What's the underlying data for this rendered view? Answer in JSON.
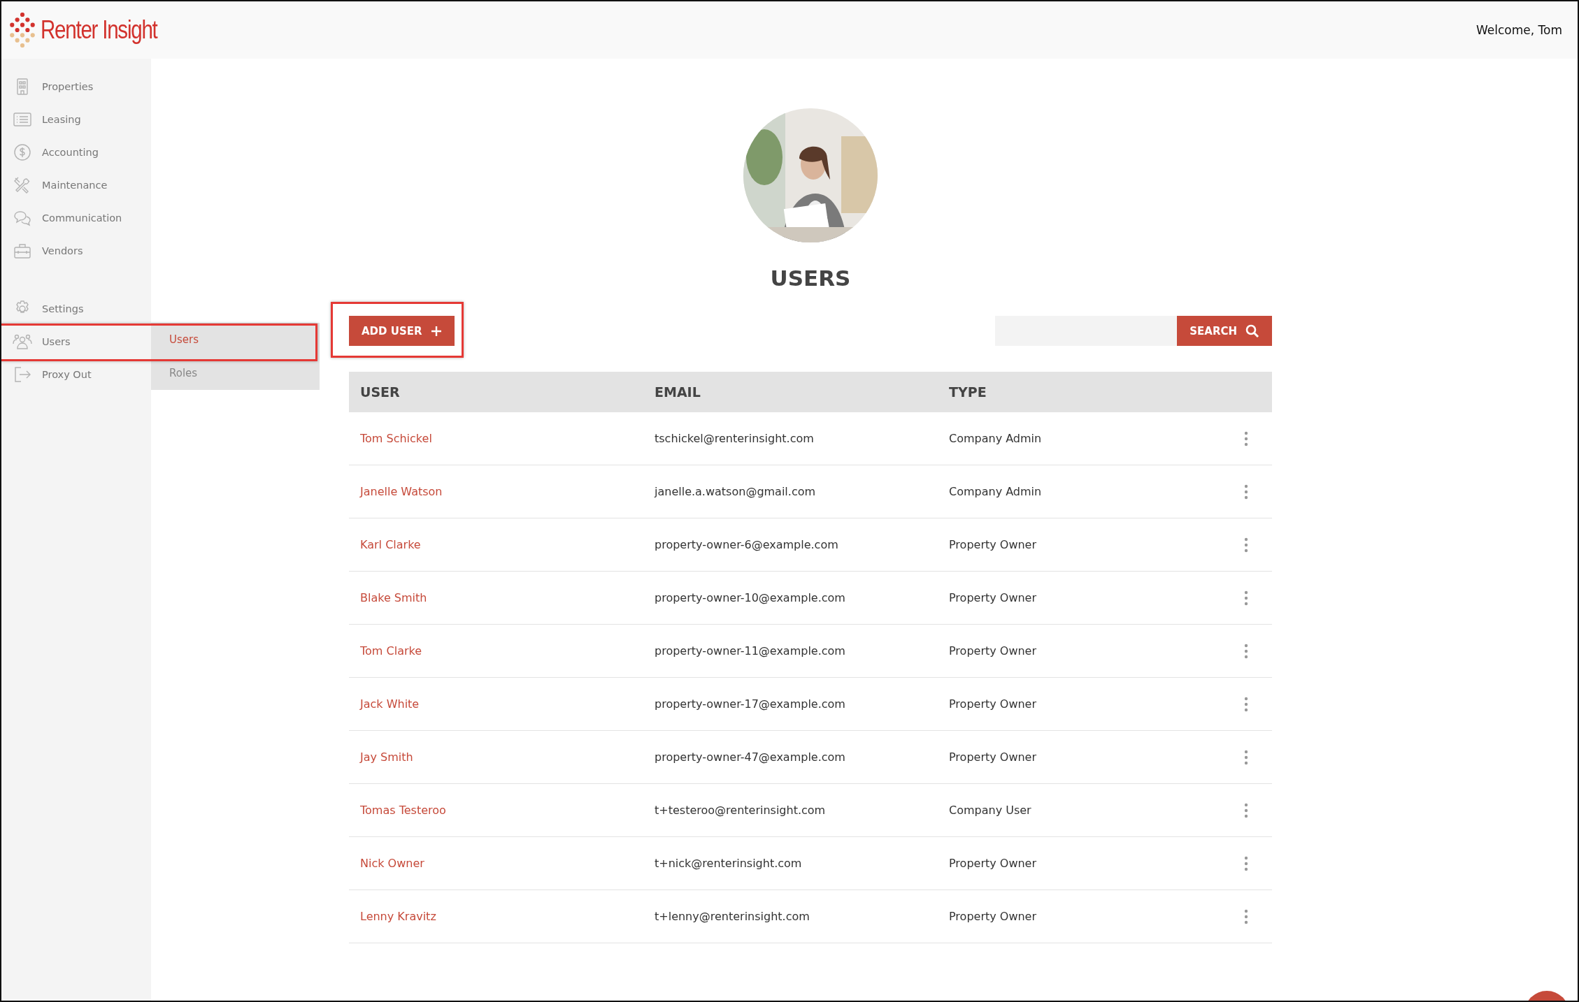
{
  "header": {
    "logo": "Renter Insight",
    "welcome": "Welcome, Tom"
  },
  "sidebar": {
    "main_items": [
      {
        "label": "Properties",
        "highlighted": false
      },
      {
        "label": "Leasing",
        "highlighted": false
      },
      {
        "label": "Accounting",
        "highlighted": false
      },
      {
        "label": "Maintenance",
        "highlighted": false
      },
      {
        "label": "Communication",
        "highlighted": false
      },
      {
        "label": "Vendors",
        "highlighted": false
      }
    ],
    "admin_items": [
      {
        "label": "Settings",
        "highlighted": false
      },
      {
        "label": "Users",
        "highlighted": true
      },
      {
        "label": "Proxy Out",
        "highlighted": false
      }
    ]
  },
  "submenu": [
    {
      "label": "Users",
      "selected": true
    },
    {
      "label": "Roles",
      "selected": false
    }
  ],
  "page": {
    "title": "USERS",
    "add_button": {
      "label": "ADD USER",
      "highlighted": true
    },
    "search_button": "SEARCH"
  },
  "table": {
    "columns": [
      "USER",
      "EMAIL",
      "TYPE"
    ],
    "rows": [
      {
        "user": "Tom Schickel",
        "email": "tschickel@renterinsight.com",
        "type": "Company Admin"
      },
      {
        "user": "Janelle Watson",
        "email": "janelle.a.watson@gmail.com",
        "type": "Company Admin"
      },
      {
        "user": "Karl Clarke",
        "email": "property-owner-6@example.com",
        "type": "Property Owner"
      },
      {
        "user": "Blake Smith",
        "email": "property-owner-10@example.com",
        "type": "Property Owner"
      },
      {
        "user": "Tom Clarke",
        "email": "property-owner-11@example.com",
        "type": "Property Owner"
      },
      {
        "user": "Jack White",
        "email": "property-owner-17@example.com",
        "type": "Property Owner"
      },
      {
        "user": "Jay Smith",
        "email": "property-owner-47@example.com",
        "type": "Property Owner"
      },
      {
        "user": "Tomas Testeroo",
        "email": "t+testeroo@renterinsight.com",
        "type": "Company User"
      },
      {
        "user": "Nick Owner",
        "email": "t+nick@renterinsight.com",
        "type": "Property Owner"
      },
      {
        "user": "Lenny Kravitz",
        "email": "t+lenny@renterinsight.com",
        "type": "Property Owner"
      }
    ]
  }
}
